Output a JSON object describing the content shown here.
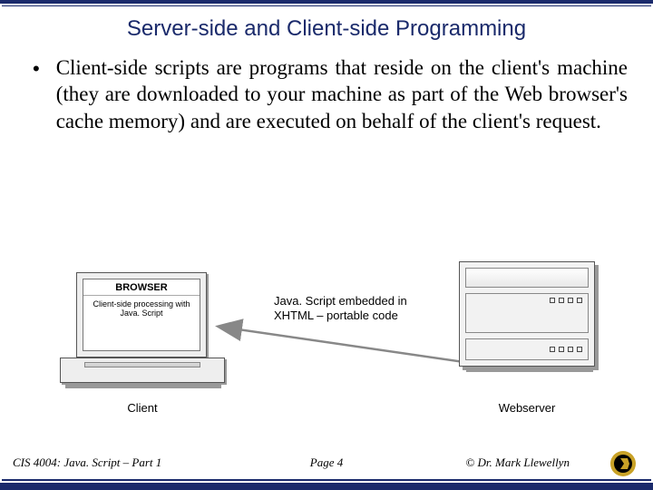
{
  "title": "Server-side and Client-side Programming",
  "bullet": "Client-side scripts are programs that reside on the client's machine (they are downloaded to your machine as part of the Web browser's cache memory) and are executed on behalf of the client's request.",
  "diagram": {
    "browser_title": "BROWSER",
    "browser_desc": "Client-side processing with Java. Script",
    "arrow_label": "Java. Script embedded in XHTML – portable code",
    "client_caption": "Client",
    "server_caption": "Webserver"
  },
  "footer": {
    "left": "CIS 4004: Java. Script – Part 1",
    "center": "Page 4",
    "right": "© Dr. Mark Llewellyn"
  }
}
